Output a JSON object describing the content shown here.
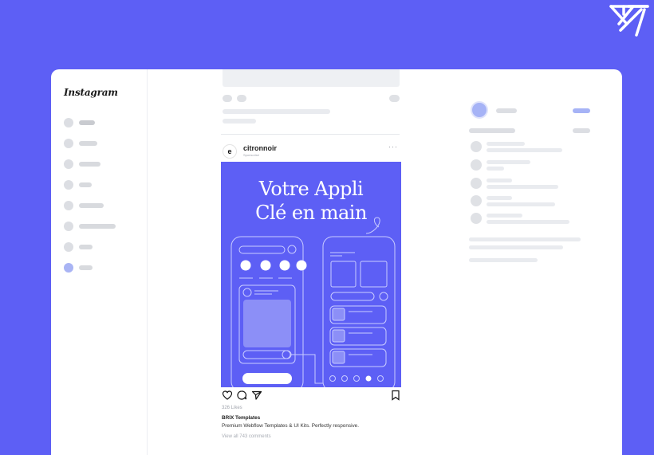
{
  "colors": {
    "background": "#5d5ff5",
    "accent": "#a6b3f6",
    "skeleton": "#e9ebef"
  },
  "app": {
    "logo": "Instagram"
  },
  "sidebar": {
    "items": [
      {
        "icon": "home-icon"
      },
      {
        "icon": "search-icon"
      },
      {
        "icon": "explore-icon"
      },
      {
        "icon": "reels-icon"
      },
      {
        "icon": "messages-icon"
      },
      {
        "icon": "notifications-icon"
      },
      {
        "icon": "create-icon"
      },
      {
        "icon": "profile-icon",
        "active": true
      }
    ]
  },
  "post": {
    "username": "citronnoir",
    "subtitle": "Sponsorisé",
    "avatar_letter": "e",
    "more_label": "···",
    "image": {
      "headline_line1": "Votre Appli",
      "headline_line2": "Clé en main"
    },
    "likes": "326 Likes",
    "caption_user": "BRIX Templates",
    "caption_text": "Premium Webflow Templates & UI Kits. Perfectly responsive.",
    "comments_link": "View all 743 comments"
  }
}
